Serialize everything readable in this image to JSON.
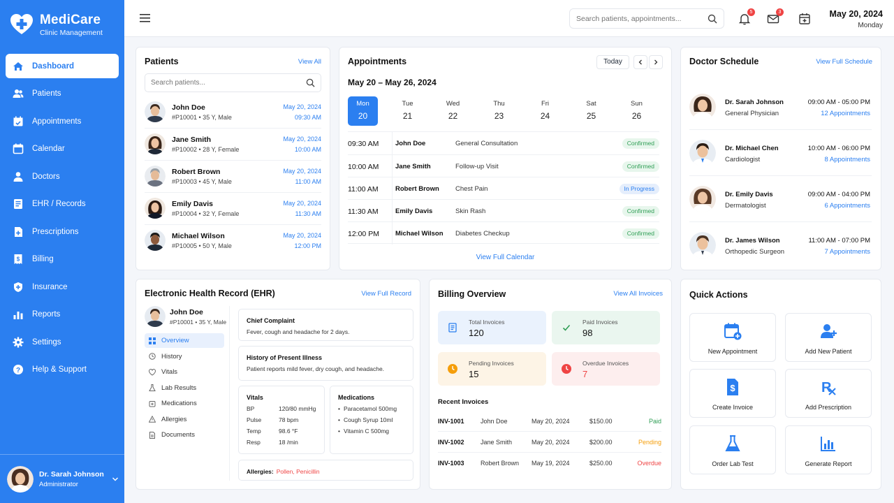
{
  "app": {
    "name": "MediCare",
    "subtitle": "Clinic Management"
  },
  "sidebar": {
    "items": [
      {
        "label": "Dashboard",
        "icon": "home-icon",
        "active": true
      },
      {
        "label": "Patients",
        "icon": "users-icon"
      },
      {
        "label": "Appointments",
        "icon": "calendar-check-icon"
      },
      {
        "label": "Calendar",
        "icon": "calendar-icon"
      },
      {
        "label": "Doctors",
        "icon": "doctor-icon"
      },
      {
        "label": "EHR / Records",
        "icon": "records-icon"
      },
      {
        "label": "Prescriptions",
        "icon": "prescription-icon"
      },
      {
        "label": "Billing",
        "icon": "billing-icon"
      },
      {
        "label": "Insurance",
        "icon": "shield-icon"
      },
      {
        "label": "Reports",
        "icon": "chart-icon"
      },
      {
        "label": "Settings",
        "icon": "gear-icon"
      },
      {
        "label": "Help & Support",
        "icon": "help-icon"
      }
    ],
    "user": {
      "name": "Dr. Sarah Johnson",
      "role": "Administrator"
    }
  },
  "topbar": {
    "search_placeholder": "Search patients, appointments...",
    "notifications_count": "5",
    "messages_count": "3",
    "date": "May 20, 2024",
    "weekday": "Monday"
  },
  "patients": {
    "title": "Patients",
    "view_all": "View All",
    "search_placeholder": "Search patients...",
    "rows": [
      {
        "name": "John Doe",
        "meta": "#P10001  •  35 Y, Male",
        "date": "May 20, 2024",
        "time": "09:30 AM"
      },
      {
        "name": "Jane Smith",
        "meta": "#P10002  •  28 Y, Female",
        "date": "May 20, 2024",
        "time": "10:00 AM"
      },
      {
        "name": "Robert Brown",
        "meta": "#P10003  •  45 Y, Male",
        "date": "May 20, 2024",
        "time": "11:00 AM"
      },
      {
        "name": "Emily Davis",
        "meta": "#P10004  •  32 Y, Female",
        "date": "May 20, 2024",
        "time": "11:30 AM"
      },
      {
        "name": "Michael Wilson",
        "meta": "#P10005  •  50 Y, Male",
        "date": "May 20, 2024",
        "time": "12:00 PM"
      }
    ]
  },
  "appointments": {
    "title": "Appointments",
    "today": "Today",
    "range": "May 20 – May 26, 2024",
    "days": [
      {
        "w": "Mon",
        "n": "20",
        "active": true
      },
      {
        "w": "Tue",
        "n": "21"
      },
      {
        "w": "Wed",
        "n": "22"
      },
      {
        "w": "Thu",
        "n": "23"
      },
      {
        "w": "Fri",
        "n": "24"
      },
      {
        "w": "Sat",
        "n": "25"
      },
      {
        "w": "Sun",
        "n": "26"
      }
    ],
    "rows": [
      {
        "time": "09:30 AM",
        "name": "John Doe",
        "type": "General Consultation",
        "status": "Confirmed"
      },
      {
        "time": "10:00 AM",
        "name": "Jane Smith",
        "type": "Follow-up Visit",
        "status": "Confirmed"
      },
      {
        "time": "11:00 AM",
        "name": "Robert Brown",
        "type": "Chest Pain",
        "status": "In Progress"
      },
      {
        "time": "11:30 AM",
        "name": "Emily Davis",
        "type": "Skin Rash",
        "status": "Confirmed"
      },
      {
        "time": "12:00 PM",
        "name": "Michael Wilson",
        "type": "Diabetes Checkup",
        "status": "Confirmed"
      }
    ],
    "view_full": "View Full Calendar"
  },
  "doctors": {
    "title": "Doctor Schedule",
    "view_full": "View Full Schedule",
    "rows": [
      {
        "name": "Dr. Sarah Johnson",
        "spec": "General Physician",
        "hours": "09:00 AM - 05:00 PM",
        "appts": "12 Appointments"
      },
      {
        "name": "Dr. Michael Chen",
        "spec": "Cardiologist",
        "hours": "10:00 AM - 06:00 PM",
        "appts": "8 Appointments"
      },
      {
        "name": "Dr. Emily Davis",
        "spec": "Dermatologist",
        "hours": "09:00 AM - 04:00 PM",
        "appts": "6 Appointments"
      },
      {
        "name": "Dr. James Wilson",
        "spec": "Orthopedic Surgeon",
        "hours": "11:00 AM - 07:00 PM",
        "appts": "7 Appointments"
      }
    ]
  },
  "ehr": {
    "title": "Electronic Health Record (EHR)",
    "view_full": "View Full Record",
    "patient": {
      "name": "John Doe",
      "meta": "#P10001  •  35 Y, Male"
    },
    "nav": [
      {
        "label": "Overview",
        "icon": "grid-icon",
        "active": true
      },
      {
        "label": "History",
        "icon": "clock-icon"
      },
      {
        "label": "Vitals",
        "icon": "heart-icon"
      },
      {
        "label": "Lab Results",
        "icon": "flask-icon"
      },
      {
        "label": "Medications",
        "icon": "pill-icon"
      },
      {
        "label": "Allergies",
        "icon": "warning-icon"
      },
      {
        "label": "Documents",
        "icon": "document-icon"
      }
    ],
    "chief_complaint": {
      "title": "Chief Complaint",
      "text": "Fever, cough and headache for 2 days."
    },
    "history": {
      "title": "History of Present Illness",
      "text": "Patient reports mild fever, dry cough, and headache."
    },
    "vitals": {
      "title": "Vitals",
      "items": [
        {
          "k": "BP",
          "v": "120/80 mmHg"
        },
        {
          "k": "Pulse",
          "v": "78 bpm"
        },
        {
          "k": "Temp",
          "v": "98.6 °F"
        },
        {
          "k": "Resp",
          "v": "18 /min"
        }
      ]
    },
    "medications": {
      "title": "Medications",
      "items": [
        "Paracetamol 500mg",
        "Cough Syrup 10ml",
        "Vitamin C 500mg"
      ]
    },
    "allergies": {
      "label": "Allergies:",
      "value": "Pollen, Penicillin"
    }
  },
  "billing": {
    "title": "Billing Overview",
    "view_all": "View All Invoices",
    "stats": [
      {
        "label": "Total Invoices",
        "value": "120",
        "icon": "invoice-icon",
        "bg": "#eaf2fd",
        "color": "#2b7ff0"
      },
      {
        "label": "Paid Invoices",
        "value": "98",
        "icon": "check-icon",
        "bg": "#eaf6ef",
        "color": "#2f9e55"
      },
      {
        "label": "Pending Invoices",
        "value": "15",
        "icon": "clock-icon",
        "bg": "#fdf4e6",
        "color": "#f59e0b"
      },
      {
        "label": "Overdue Invoices",
        "value": "7",
        "icon": "alert-icon",
        "bg": "#fdeeee",
        "color": "#ef4444"
      }
    ],
    "recent_title": "Recent Invoices",
    "invoices": [
      {
        "id": "INV-1001",
        "name": "John Doe",
        "date": "May 20, 2024",
        "amount": "$150.00",
        "status": "Paid",
        "color": "#2f9e55"
      },
      {
        "id": "INV-1002",
        "name": "Jane Smith",
        "date": "May 20, 2024",
        "amount": "$200.00",
        "status": "Pending",
        "color": "#f59e0b"
      },
      {
        "id": "INV-1003",
        "name": "Robert Brown",
        "date": "May 19, 2024",
        "amount": "$250.00",
        "status": "Overdue",
        "color": "#ef4444"
      }
    ]
  },
  "quick_actions": {
    "title": "Quick Actions",
    "items": [
      {
        "label": "New Appointment",
        "icon": "calendar-plus-icon"
      },
      {
        "label": "Add New Patient",
        "icon": "user-plus-icon"
      },
      {
        "label": "Create Invoice",
        "icon": "invoice-dollar-icon"
      },
      {
        "label": "Add Prescription",
        "icon": "rx-icon"
      },
      {
        "label": "Order Lab Test",
        "icon": "flask-icon"
      },
      {
        "label": "Generate Report",
        "icon": "report-icon"
      }
    ]
  },
  "colors": {
    "primary": "#2b7ff0",
    "success": "#2f9e55",
    "warning": "#f59e0b",
    "danger": "#ef4444"
  }
}
